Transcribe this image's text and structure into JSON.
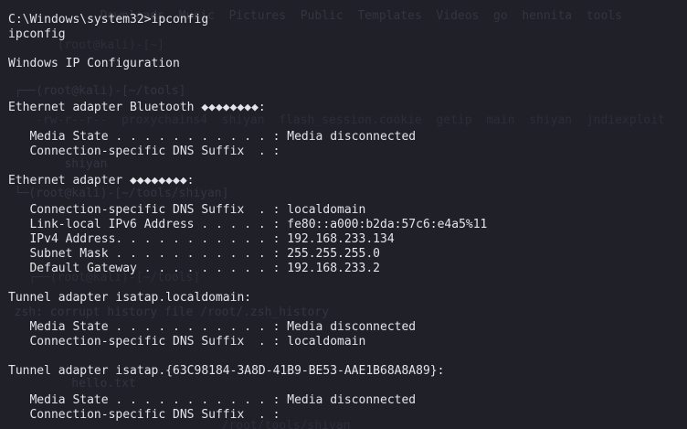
{
  "terminal": {
    "lines": [
      "C:\\Windows\\system32>ipconfig",
      "ipconfig",
      "",
      "Windows IP Configuration",
      "",
      "",
      "Ethernet adapter Bluetooth ◆◆◆◆◆◆◆◆:",
      "",
      "   Media State . . . . . . . . . . . : Media disconnected",
      "   Connection-specific DNS Suffix  . :",
      "",
      "Ethernet adapter ◆◆◆◆◆◆◆◆:",
      "",
      "   Connection-specific DNS Suffix  . : localdomain",
      "   Link-local IPv6 Address . . . . . : fe80::a000:b2da:57c6:e4a5%11",
      "   IPv4 Address. . . . . . . . . . . : 192.168.233.134",
      "   Subnet Mask . . . . . . . . . . . : 255.255.255.0",
      "   Default Gateway . . . . . . . . . : 192.168.233.2",
      "",
      "Tunnel adapter isatap.localdomain:",
      "",
      "   Media State . . . . . . . . . . . : Media disconnected",
      "   Connection-specific DNS Suffix  . : localdomain",
      "",
      "Tunnel adapter isatap.{63C98184-3A8D-41B9-BE53-AAE1B68A8A89}:",
      "",
      "   Media State . . . . . . . . . . . : Media disconnected",
      "   Connection-specific DNS Suffix  . :"
    ]
  },
  "background_shell": {
    "lines": [
      "              Downloads  Music  Pictures  Public  Templates  Videos  go  hennita  tools",
      "        (root@kali)-[~]",
      "  ┌──(root@kali)-[~/tools]",
      "     -rw-r--r--  proxychains4  shiyan  flash_session.cookie  getip  main  shiyan  jndiexploit",
      "         shiyan",
      "  └─(root@kali)-[~/tools/shiyan]",
      "    ┌──(root@kali)-[~/tools]",
      "  zsh: corrupt history file /root/.zsh_history",
      "          hello.txt",
      "                               /root/tools/shiyan"
    ]
  }
}
